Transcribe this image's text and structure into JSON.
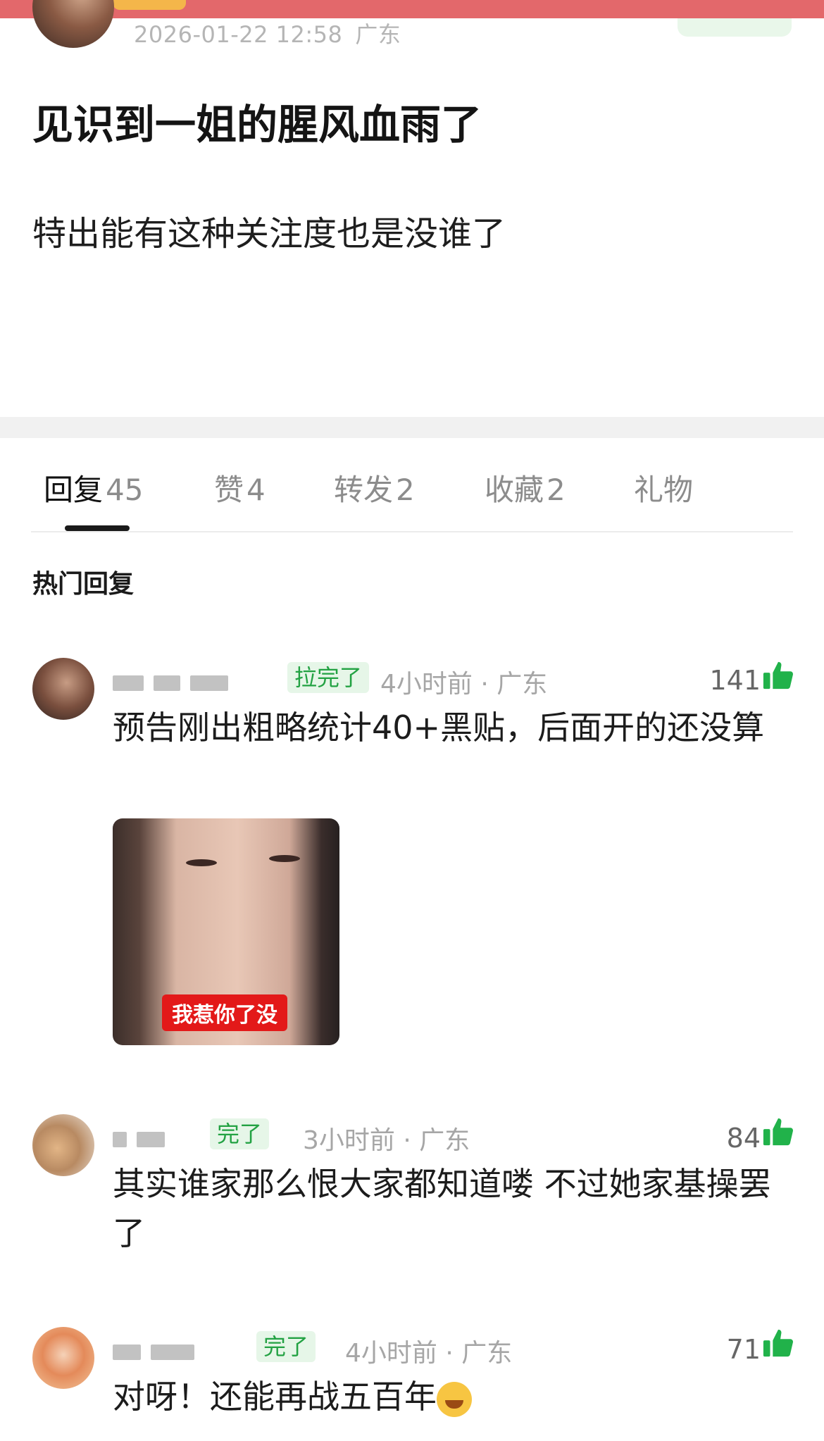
{
  "post": {
    "date": "2026-01-22 12:58",
    "location": "广东",
    "title": "见识到一姐的腥风血雨了",
    "body": "特出能有这种关注度也是没谁了"
  },
  "tabs": [
    {
      "label": "回复",
      "count": "45"
    },
    {
      "label": "赞",
      "count": "4"
    },
    {
      "label": "转发",
      "count": "2"
    },
    {
      "label": "收藏",
      "count": "2"
    },
    {
      "label": "礼物",
      "count": ""
    }
  ],
  "section_title": "热门回复",
  "comments": [
    {
      "badge": "拉完了",
      "meta": "4小时前 · 广东",
      "likes": "141",
      "text": "预告刚出粗略统计40+黑贴，后面开的还没算",
      "image_caption": "我惹你了没"
    },
    {
      "badge": "完了",
      "meta": "3小时前 · 广东",
      "likes": "84",
      "text": "其实谁家那么恨大家都知道喽 不过她家基操罢了"
    },
    {
      "badge": "完了",
      "meta": "4小时前 · 广东",
      "likes": "71",
      "text": "对呀！还能再战五百年"
    }
  ],
  "colors": {
    "accent_green": "#23a243",
    "top_bar": "#e3686b",
    "like_icon": "#21b24a"
  },
  "icons": [
    "thumbs-up-icon",
    "laughing-emoji-icon"
  ]
}
